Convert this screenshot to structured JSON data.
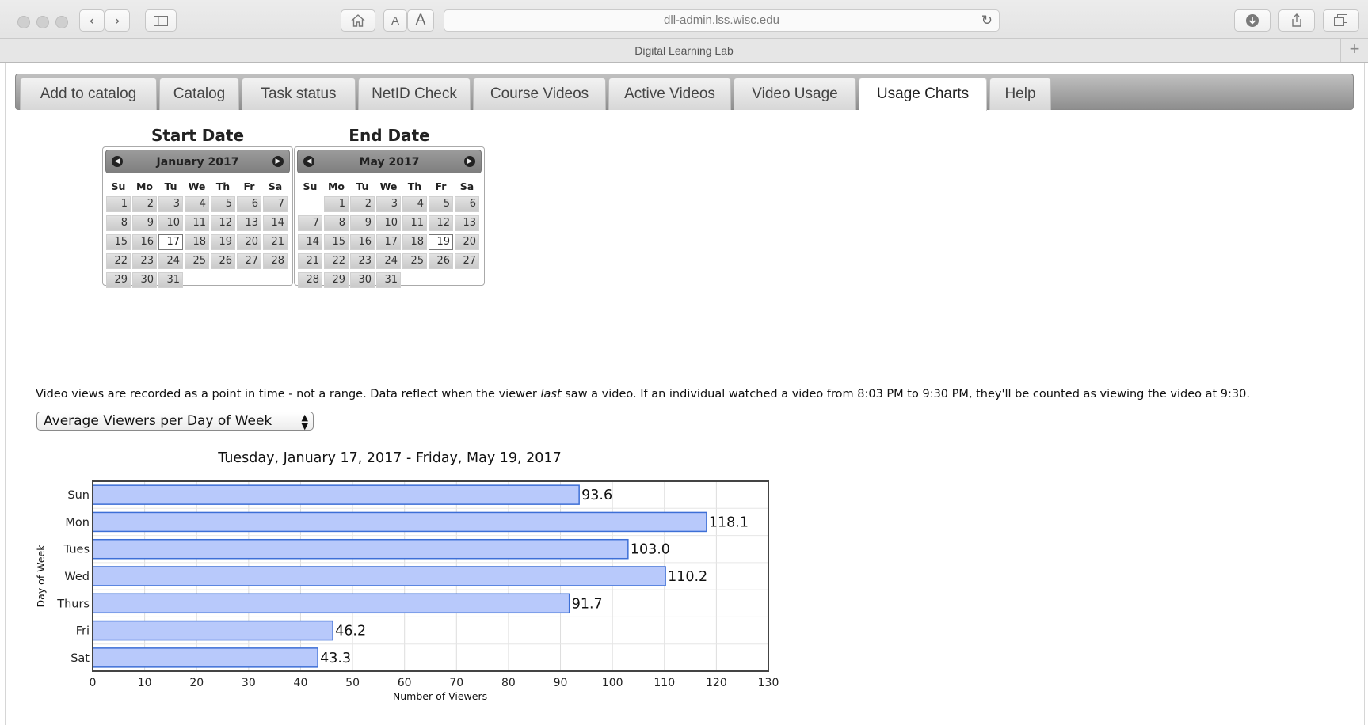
{
  "browser": {
    "url": "dll-admin.lss.wisc.edu",
    "page_title": "Digital Learning Lab",
    "font_small": "A",
    "font_large": "A"
  },
  "tabs": [
    {
      "label": "Add to catalog",
      "active": false
    },
    {
      "label": "Catalog",
      "active": false
    },
    {
      "label": "Task status",
      "active": false
    },
    {
      "label": "NetID Check",
      "active": false
    },
    {
      "label": "Course Videos",
      "active": false
    },
    {
      "label": "Active Videos",
      "active": false
    },
    {
      "label": "Video Usage",
      "active": false
    },
    {
      "label": "Usage Charts",
      "active": true
    },
    {
      "label": "Help",
      "active": false
    }
  ],
  "start_date": {
    "heading": "Start Date",
    "month_label": "January 2017",
    "weekdays": [
      "Su",
      "Mo",
      "Tu",
      "We",
      "Th",
      "Fr",
      "Sa"
    ],
    "first_weekday_index": 0,
    "days_in_month": 31,
    "selected_day": 17
  },
  "end_date": {
    "heading": "End Date",
    "month_label": "May 2017",
    "weekdays": [
      "Su",
      "Mo",
      "Tu",
      "We",
      "Th",
      "Fr",
      "Sa"
    ],
    "first_weekday_index": 1,
    "days_in_month": 31,
    "selected_day": 19
  },
  "note": {
    "before": "Video views are recorded as a point in time - not a range. Data reflect when the viewer ",
    "emphasis": "last",
    "after": " saw a video. If an individual watched a video from 8:03 PM to 9:30 PM, they'll be counted as viewing the video at 9:30."
  },
  "chart_select": {
    "selected": "Average Viewers per Day of Week"
  },
  "chart_data": {
    "type": "bar",
    "orientation": "horizontal",
    "title": "Tuesday, January 17, 2017 - Friday, May 19, 2017",
    "categories": [
      "Sun",
      "Mon",
      "Tues",
      "Wed",
      "Thurs",
      "Fri",
      "Sat"
    ],
    "values": [
      93.6,
      118.1,
      103.0,
      110.2,
      91.7,
      46.2,
      43.3
    ],
    "value_labels": [
      "93.6",
      "118.1",
      "103.0",
      "110.2",
      "91.7",
      "46.2",
      "43.3"
    ],
    "xlabel": "Number of Viewers",
    "ylabel": "Day of Week",
    "xlim": [
      0,
      130
    ],
    "xticks": [
      0,
      10,
      20,
      30,
      40,
      50,
      60,
      70,
      80,
      90,
      100,
      110,
      120,
      130
    ],
    "grid": true,
    "bar_color": "#b8c9fb",
    "bar_edge_color": "#3d6fd6"
  }
}
